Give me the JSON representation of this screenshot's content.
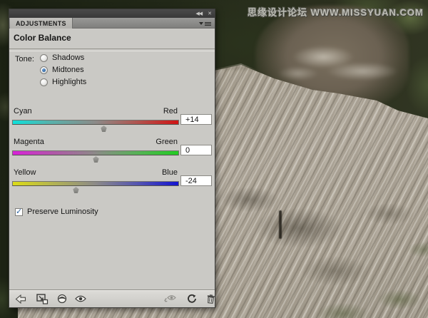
{
  "watermark": {
    "text": "思缘设计论坛 WWW.MISSYUAN.COM"
  },
  "panel": {
    "titlebar": {
      "collapse_icon": "◀◀",
      "close_icon": "✕"
    },
    "tab_label": "ADJUSTMENTS",
    "title": "Color Balance",
    "tone": {
      "label": "Tone:",
      "options": [
        {
          "label": "Shadows",
          "selected": false
        },
        {
          "label": "Midtones",
          "selected": true
        },
        {
          "label": "Highlights",
          "selected": false
        }
      ]
    },
    "sliders": [
      {
        "left_label": "Cyan",
        "right_label": "Red",
        "value": "+14"
      },
      {
        "left_label": "Magenta",
        "right_label": "Green",
        "value": "0"
      },
      {
        "left_label": "Yellow",
        "right_label": "Blue",
        "value": "-24"
      }
    ],
    "preserve_luminosity": {
      "label": "Preserve Luminosity",
      "checked": true,
      "check_glyph": "✓"
    },
    "toolbar_icon_names": [
      "back-arrow-icon",
      "expanded-view-icon",
      "clip-to-layer-icon",
      "visibility-eye-icon",
      "previous-state-eye-icon",
      "reset-icon",
      "delete-trash-icon"
    ]
  },
  "colors": {
    "accent_blue": "#2f66a2",
    "slider_cyan": "#0ee0da",
    "slider_red": "#d01414",
    "slider_magenta": "#d822d8",
    "slider_green": "#22cc22",
    "slider_yellow": "#dcdc16",
    "slider_blue": "#1414d0",
    "panel_body": "#cac9c5",
    "titlebar": "#3a3a3a"
  }
}
